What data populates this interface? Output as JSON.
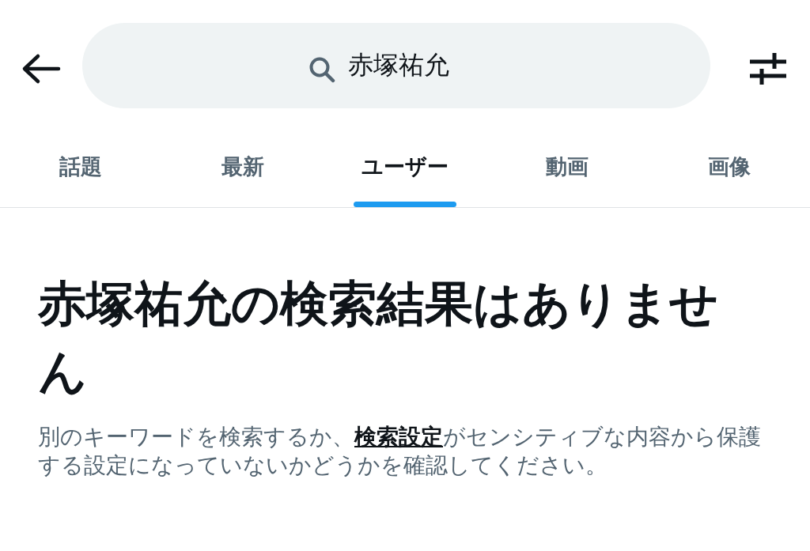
{
  "search": {
    "value": "赤塚祐允"
  },
  "tabs": [
    {
      "label": "話題",
      "selected": false
    },
    {
      "label": "最新",
      "selected": false
    },
    {
      "label": "ユーザー",
      "selected": true
    },
    {
      "label": "動画",
      "selected": false
    },
    {
      "label": "画像",
      "selected": false
    }
  ],
  "empty_state": {
    "title": "赤塚祐允の検索結果はありません",
    "hint_before": "別のキーワードを検索するか、",
    "hint_link": "検索設定",
    "hint_after": "がセンシティブな内容から保護する設定になっていないかどうかを確認してください。"
  }
}
